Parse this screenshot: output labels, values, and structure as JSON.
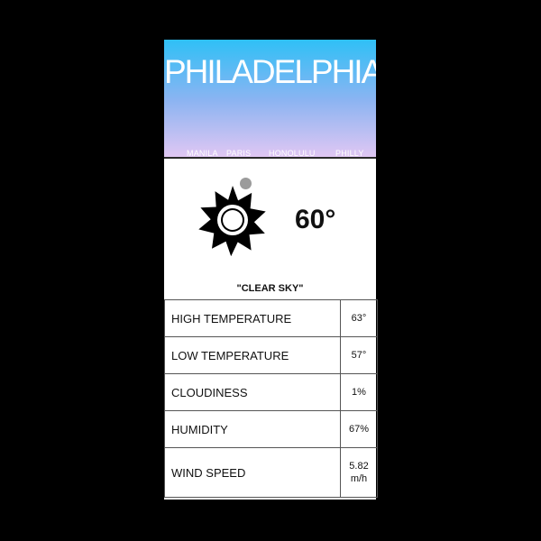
{
  "header": {
    "city_title": "PHILADELPHIA",
    "tabs": [
      {
        "label": "MANILA"
      },
      {
        "label": "PARIS"
      },
      {
        "label": "HONOLULU"
      },
      {
        "label": "PHILLY"
      }
    ]
  },
  "current": {
    "icon": "sun-icon",
    "temperature": "60°",
    "description": "\"CLEAR SKY\""
  },
  "stats": [
    {
      "label": "HIGH TEMPERATURE",
      "value": "63°"
    },
    {
      "label": "LOW TEMPERATURE",
      "value": "57°"
    },
    {
      "label": "CLOUDINESS",
      "value": "1%"
    },
    {
      "label": "HUMIDITY",
      "value": "67%"
    },
    {
      "label": "WIND SPEED",
      "value": "5.82 m/h"
    }
  ],
  "colors": {
    "background": "#000000",
    "gradient_top": "#2fc0f6",
    "gradient_bottom": "#e0c7f3",
    "card": "#ffffff"
  }
}
